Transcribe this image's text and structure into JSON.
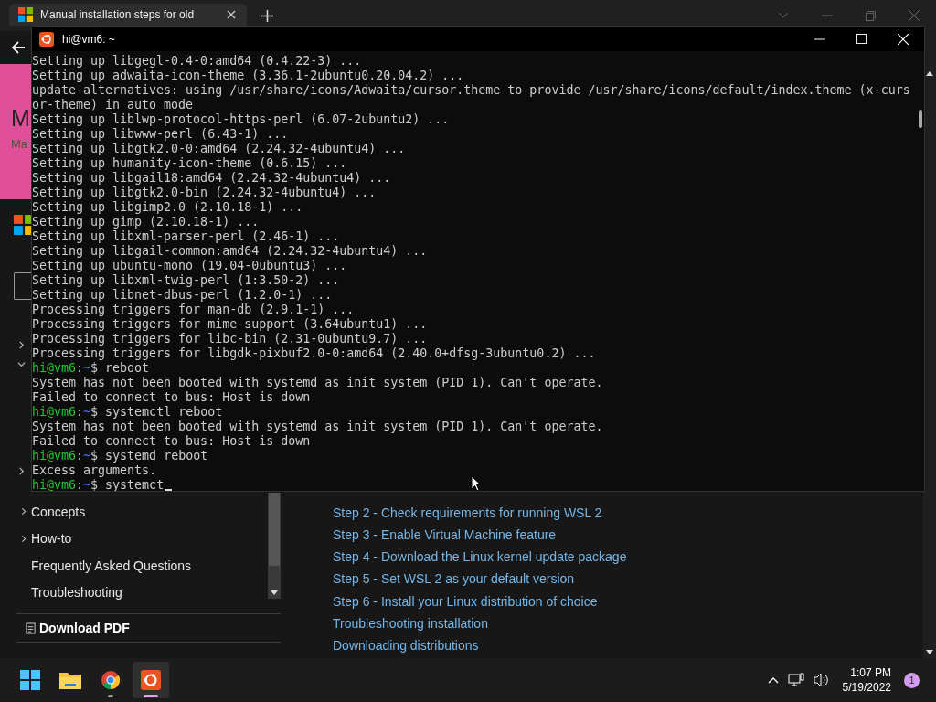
{
  "browser": {
    "tab": {
      "title": "Manual installation steps for old"
    },
    "banner": {
      "heading": "M",
      "subheading": "Ma"
    },
    "hidden_nav": [
      {
        "expanded": false
      },
      {
        "expanded": true
      },
      {
        "expanded": false
      }
    ],
    "nav": [
      {
        "label": "Concepts",
        "expandable": true
      },
      {
        "label": "How-to",
        "expandable": true
      },
      {
        "label": "Frequently Asked Questions",
        "expandable": false
      },
      {
        "label": "Troubleshooting",
        "expandable": false
      }
    ],
    "download": "Download PDF",
    "links": [
      "Step 2 - Check requirements for running WSL 2",
      "Step 3 - Enable Virtual Machine feature",
      "Step 4 - Download the Linux kernel update package",
      "Step 5 - Set WSL 2 as your default version",
      "Step 6 - Install your Linux distribution of choice",
      "Troubleshooting installation",
      "Downloading distributions"
    ]
  },
  "terminal": {
    "title": "hi@vm6: ~",
    "cursor_visible": true,
    "lines": [
      {
        "kind": "output",
        "text": "Setting up libgegl-0.4-0:amd64 (0.4.22-3) ..."
      },
      {
        "kind": "output",
        "text": "Setting up adwaita-icon-theme (3.36.1-2ubuntu0.20.04.2) ..."
      },
      {
        "kind": "output",
        "text": "update-alternatives: using /usr/share/icons/Adwaita/cursor.theme to provide /usr/share/icons/default/index.theme (x-curs"
      },
      {
        "kind": "output",
        "text": "or-theme) in auto mode"
      },
      {
        "kind": "output",
        "text": "Setting up liblwp-protocol-https-perl (6.07-2ubuntu2) ..."
      },
      {
        "kind": "output",
        "text": "Setting up libwww-perl (6.43-1) ..."
      },
      {
        "kind": "output",
        "text": "Setting up libgtk2.0-0:amd64 (2.24.32-4ubuntu4) ..."
      },
      {
        "kind": "output",
        "text": "Setting up humanity-icon-theme (0.6.15) ..."
      },
      {
        "kind": "output",
        "text": "Setting up libgail18:amd64 (2.24.32-4ubuntu4) ..."
      },
      {
        "kind": "output",
        "text": "Setting up libgtk2.0-bin (2.24.32-4ubuntu4) ..."
      },
      {
        "kind": "output",
        "text": "Setting up libgimp2.0 (2.10.18-1) ..."
      },
      {
        "kind": "output",
        "text": "Setting up gimp (2.10.18-1) ..."
      },
      {
        "kind": "output",
        "text": "Setting up libxml-parser-perl (2.46-1) ..."
      },
      {
        "kind": "output",
        "text": "Setting up libgail-common:amd64 (2.24.32-4ubuntu4) ..."
      },
      {
        "kind": "output",
        "text": "Setting up ubuntu-mono (19.04-0ubuntu3) ..."
      },
      {
        "kind": "output",
        "text": "Setting up libxml-twig-perl (1:3.50-2) ..."
      },
      {
        "kind": "output",
        "text": "Setting up libnet-dbus-perl (1.2.0-1) ..."
      },
      {
        "kind": "output",
        "text": "Processing triggers for man-db (2.9.1-1) ..."
      },
      {
        "kind": "output",
        "text": "Processing triggers for mime-support (3.64ubuntu1) ..."
      },
      {
        "kind": "output",
        "text": "Processing triggers for libc-bin (2.31-0ubuntu9.7) ..."
      },
      {
        "kind": "output",
        "text": "Processing triggers for libgdk-pixbuf2.0-0:amd64 (2.40.0+dfsg-3ubuntu0.2) ..."
      },
      {
        "kind": "prompt",
        "user": "hi@vm6",
        "sep": ":",
        "path": "~",
        "symbol": "$",
        "command": "reboot"
      },
      {
        "kind": "output",
        "text": "System has not been booted with systemd as init system (PID 1). Can't operate."
      },
      {
        "kind": "output",
        "text": "Failed to connect to bus: Host is down"
      },
      {
        "kind": "prompt",
        "user": "hi@vm6",
        "sep": ":",
        "path": "~",
        "symbol": "$",
        "command": "systemctl reboot"
      },
      {
        "kind": "output",
        "text": "System has not been booted with systemd as init system (PID 1). Can't operate."
      },
      {
        "kind": "output",
        "text": "Failed to connect to bus: Host is down"
      },
      {
        "kind": "prompt",
        "user": "hi@vm6",
        "sep": ":",
        "path": "~",
        "symbol": "$",
        "command": "systemd reboot"
      },
      {
        "kind": "output",
        "text": "Excess arguments."
      },
      {
        "kind": "prompt",
        "user": "hi@vm6",
        "sep": ":",
        "path": "~",
        "symbol": "$",
        "command": "systemct"
      }
    ]
  },
  "taskbar": {
    "apps": [
      {
        "kind": "start",
        "selected": false,
        "running": false
      },
      {
        "kind": "files",
        "selected": false,
        "running": false
      },
      {
        "kind": "chrome",
        "selected": false,
        "running": true
      },
      {
        "kind": "ubuntu",
        "selected": true,
        "running": true
      }
    ],
    "time": "1:07 PM",
    "date": "5/19/2022",
    "notifications": "1"
  }
}
